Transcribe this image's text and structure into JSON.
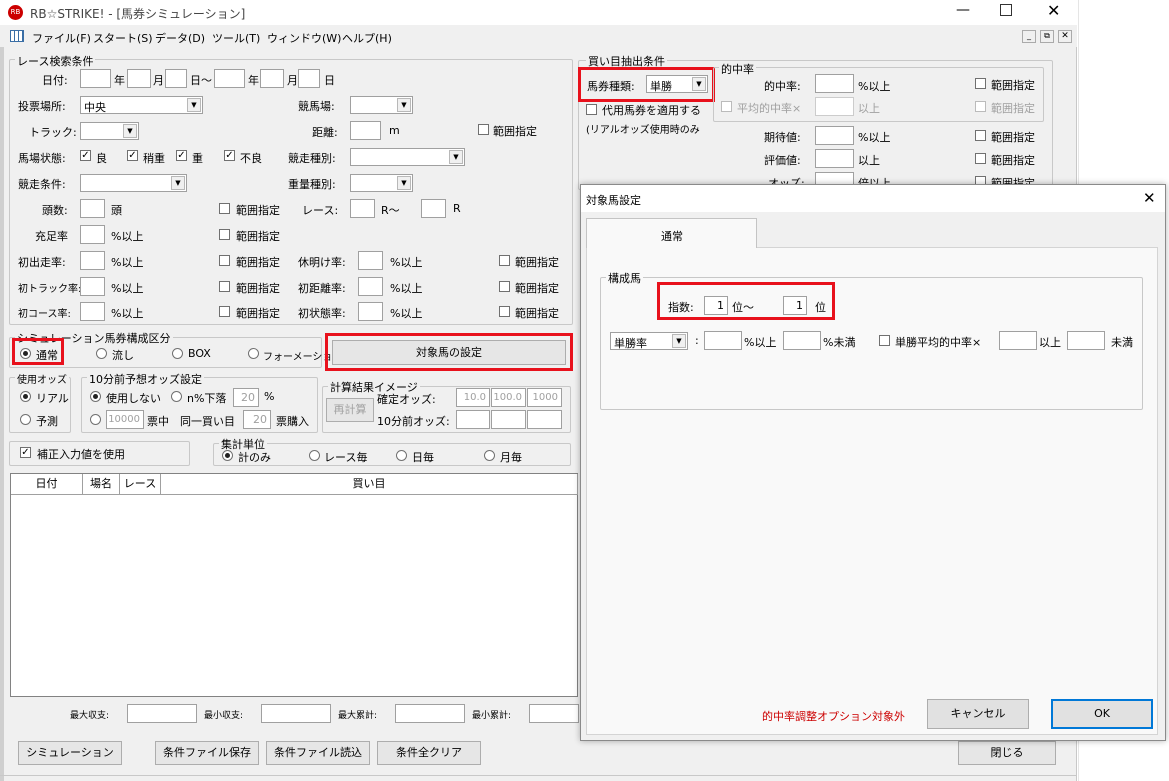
{
  "app": {
    "title": "RB☆STRIKE! - [馬券シミュレーション]"
  },
  "menu": [
    "ファイル(F)",
    "スタート(S)",
    "データ(D)",
    "ツール(T)",
    "ウィンドウ(W)",
    "ヘルプ(H)"
  ],
  "search": {
    "legend": "レース検索条件",
    "date": "日付:",
    "nen": "年",
    "tsuki": "月",
    "nichi_kara": "日～",
    "nichi": "日",
    "venue_label": "投票場所:",
    "venue_value": "中央",
    "course_label": "競馬場:",
    "track_label": "トラック:",
    "distance_label": "距離:",
    "m": "m",
    "range": "範囲指定",
    "baba_label": "馬場状態:",
    "baba": [
      "良",
      "稍重",
      "重",
      "不良"
    ],
    "syubetsu_label": "競走種別:",
    "joken_label": "競走条件:",
    "juryo_label": "重量種別:",
    "tosu_label": "頭数:",
    "to": "頭",
    "race_label": "レース:",
    "r_kara": "R～",
    "r": "R",
    "juji_label": "充足率",
    "ijo": "%以上",
    "hatsu_label": "初出走率:",
    "kyumei_label": "休明け率:",
    "hatsutrack_label": "初トラック率:",
    "hatsukyori_label": "初距離率:",
    "hatsucourse_label": "初コース率:",
    "hatsujotai_label": "初状態率:"
  },
  "sim": {
    "legend": "シミュレーション馬券構成区分",
    "options": [
      "通常",
      "流し",
      "BOX",
      "フォーメーション"
    ],
    "target_button": "対象馬の設定"
  },
  "odds": {
    "legend": "使用オッズ",
    "options": [
      "リアル",
      "予測"
    ]
  },
  "odds10": {
    "legend": "10分前予想オッズ設定",
    "not_use": "使用しない",
    "pct": "n%下落",
    "pct_value": "20",
    "pct_unit": "%",
    "hyo_value": "10000",
    "hyochu": "票中",
    "dou": "同一買い目",
    "kounyu_value": "20",
    "kounyu": "票購入"
  },
  "calc": {
    "legend": "計算結果イメージ",
    "recalc": "再計算",
    "kakutei_label": "確定オッズ:",
    "v1": "10.0",
    "v2": "100.0",
    "v3": "1000",
    "min10_label": "10分前オッズ:"
  },
  "hosei": {
    "label": "補正入力値を使用"
  },
  "unit": {
    "legend": "集計単位",
    "options": [
      "計のみ",
      "レース毎",
      "日毎",
      "月毎"
    ]
  },
  "table": {
    "headers": [
      "日付",
      "場名",
      "レース",
      "買い目"
    ]
  },
  "totals": {
    "max_income": "最大収支:",
    "min_income": "最小収支:",
    "max_cum": "最大累計:",
    "min_cum": "最小累計:"
  },
  "buttons": {
    "simulate": "シミュレーション",
    "save": "条件ファイル保存",
    "load": "条件ファイル読込",
    "clear": "条件全クリア",
    "close": "閉じる"
  },
  "kaime": {
    "legend": "買い目抽出条件",
    "bakenshu_label": "馬券種類:",
    "bakenshu_value": "単勝",
    "daiyo": "代用馬券を適用する",
    "real_only": "(リアルオッズ使用時のみ"
  },
  "hit": {
    "legend": "的中率",
    "tekichu": "的中率:",
    "ijo": "%以上",
    "ijo2": "以上",
    "heikin": "平均的中率×",
    "kitai": "期待値:",
    "hyoka": "評価値:",
    "odds": "オッズ:",
    "bai": "倍以上",
    "range": "範囲指定"
  },
  "dialog": {
    "title": "対象馬設定",
    "tab": "通常",
    "legend": "構成馬",
    "shisu": "指数:",
    "from": "1",
    "i_kara": "位～",
    "to": "1",
    "i": "位",
    "select": "単勝率",
    "ijo": "%以上",
    "miman": "%未満",
    "heikin": "単勝平均的中率×",
    "ijo2": "以上",
    "miman2": "未満",
    "note": "的中率調整オプション対象外",
    "cancel": "キャンセル",
    "ok": "OK"
  },
  "colors": {
    "highlight": "#e8111c",
    "note": "#cc0000"
  }
}
